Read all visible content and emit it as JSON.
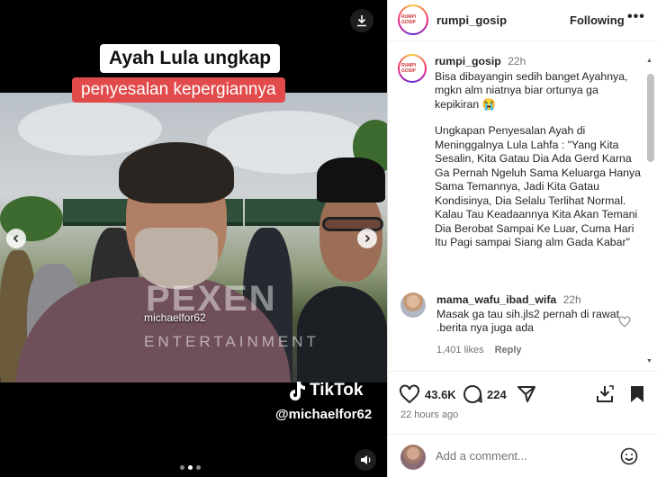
{
  "media": {
    "caption_line1": "Ayah Lula ungkap",
    "caption_line2": "penyesalan kepergiannya",
    "watermark_user": "michaelfor62",
    "watermark_brand": "PEXEN",
    "watermark_sub": "ENTERTAINMENT",
    "tiktok_label": "TikTok",
    "tiktok_user": "@michaelfor62",
    "carousel_dots": 3,
    "active_dot": 1
  },
  "header": {
    "username": "rumpi_gosip",
    "follow_label": "Following",
    "more_label": "•••",
    "avatar_text": "RUMPI GOSIP"
  },
  "caption": {
    "username": "rumpi_gosip",
    "time": "22h",
    "para1": "Bisa dibayangin sedih banget Ayahnya, mgkn alm niatnya biar ortunya ga kepikiran 😭",
    "para2": "Ungkapan Penyesalan Ayah di Meninggalnya Lula Lahfa : \"Yang Kita Sesalin, Kita Gatau Dia Ada Gerd Karna Ga Pernah Ngeluh Sama Keluarga Hanya Sama Temannya, Jadi Kita Gatau Kondisinya, Dia Selalu Terlihat Normal. Kalau Tau Keadaannya Kita Akan Temani Dia Berobat Sampai Ke Luar, Cuma Hari Itu Pagi sampai Siang  alm Gada Kabar\""
  },
  "comment": {
    "username": "mama_wafu_ibad_wifa",
    "time": "22h",
    "text": "Masak ga tau sih.jls2 pernah di rawat .berita nya juga ada",
    "likes": "1,401 likes",
    "reply_label": "Reply"
  },
  "actions": {
    "likes_count": "43.6K",
    "comments_count": "224",
    "posted": "22 hours ago"
  },
  "add_comment": {
    "placeholder": "Add a comment..."
  },
  "colors": {
    "caption_red": "#e24b4b",
    "text": "#262626",
    "muted": "#737373"
  }
}
